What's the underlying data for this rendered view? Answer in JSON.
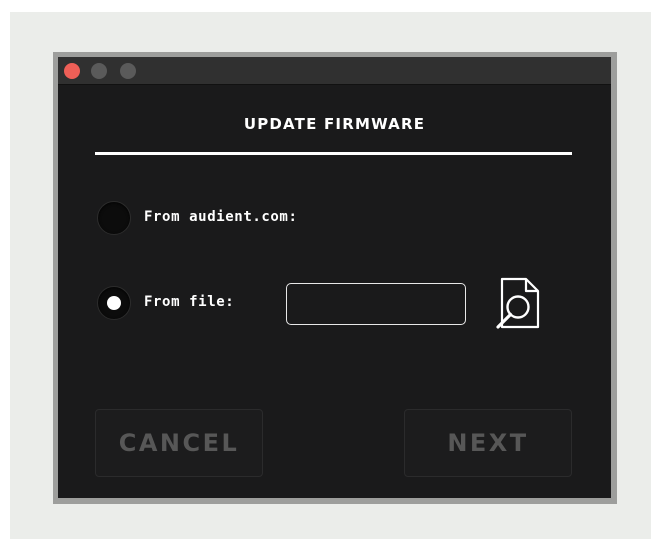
{
  "dialog": {
    "title": "UPDATE FIRMWARE"
  },
  "options": {
    "from_web_label": "From audient.com:",
    "from_web_selected": false,
    "from_file_label": "From file:",
    "from_file_selected": true
  },
  "file_input": {
    "value": ""
  },
  "icons": {
    "browse": "document-search-icon"
  },
  "buttons": {
    "cancel_label": "CANCEL",
    "next_label": "NEXT"
  },
  "colors": {
    "window_bg": "#1a1a1b",
    "titlebar_bg": "#303030",
    "close_light": "#ee5f57",
    "text": "#ffffff",
    "button_text_disabled": "#575757"
  }
}
